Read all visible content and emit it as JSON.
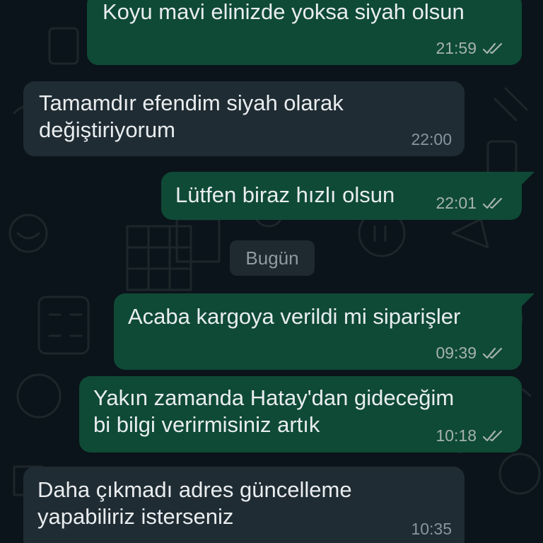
{
  "chat": {
    "day_separator": "Bugün",
    "messages": [
      {
        "direction": "out",
        "text": "Koyu mavi elinizde yoksa siyah olsun",
        "time": "21:59",
        "status": "read"
      },
      {
        "direction": "in",
        "text": "Tamamdır efendim siyah olarak\ndeğiştiriyorum",
        "time": "22:00"
      },
      {
        "direction": "out",
        "text": "Lütfen biraz hızlı olsun",
        "time": "22:01",
        "status": "read"
      },
      {
        "direction": "out",
        "text": "Acaba kargoya verildi mi siparişler",
        "time": "09:39",
        "status": "read"
      },
      {
        "direction": "out",
        "text": "Yakın zamanda Hatay'dan gideceğim\nbi bilgi verirmisiniz artık",
        "time": "10:18",
        "status": "read"
      },
      {
        "direction": "in",
        "text": "Daha çıkmadı adres güncelleme\nyapabiliriz isterseniz",
        "time": "10:35"
      }
    ]
  },
  "colors": {
    "background": "#0b141a",
    "outgoing_bubble": "#0f4a36",
    "incoming_bubble": "#202c33",
    "read_ticks": "#a6b3ad"
  },
  "icons": {
    "read_receipt": "double-check-icon"
  }
}
